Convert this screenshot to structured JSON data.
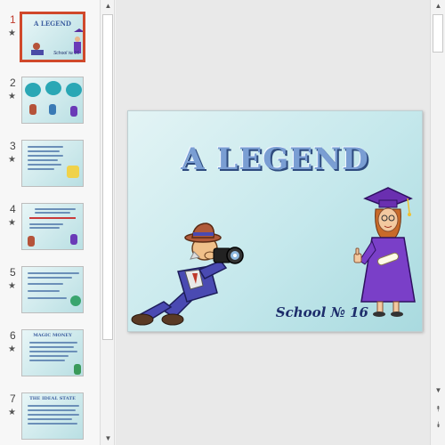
{
  "thumbnails": [
    {
      "number": "1",
      "title": "A LEGEND",
      "caption": "School № 16",
      "selected": true
    },
    {
      "number": "2",
      "title": "",
      "caption": "",
      "selected": false
    },
    {
      "number": "3",
      "title": "",
      "caption": "",
      "selected": false
    },
    {
      "number": "4",
      "title": "",
      "caption": "",
      "selected": false
    },
    {
      "number": "5",
      "title": "",
      "caption": "",
      "selected": false
    },
    {
      "number": "6",
      "title": "MAGIC MONEY",
      "caption": "",
      "selected": false
    },
    {
      "number": "7",
      "title": "THE IDEAL STATE",
      "caption": "",
      "selected": false
    }
  ],
  "star": "★",
  "slide": {
    "title": "A LEGEND",
    "subtitle": "School № 16"
  },
  "scroll": {
    "up": "▲",
    "down": "▼",
    "prev_slide": "⯭",
    "next_slide": "⯯"
  },
  "colors": {
    "accent": "#d0492b",
    "slide_title": "#7a9ed3",
    "slide_subtitle": "#1d2d6b"
  }
}
